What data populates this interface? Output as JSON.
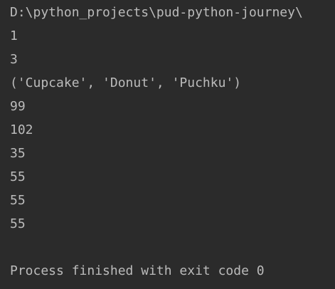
{
  "console": {
    "command_path": "D:\\python_projects\\pud-python-journey\\",
    "output_lines": [
      "1",
      "3",
      "('Cupcake', 'Donut', 'Puchku')",
      "99",
      "102",
      "35",
      "55",
      "55",
      "55"
    ],
    "exit_message": "Process finished with exit code 0"
  },
  "colors": {
    "background": "#2b2b2b",
    "text": "#bbbbbb"
  }
}
